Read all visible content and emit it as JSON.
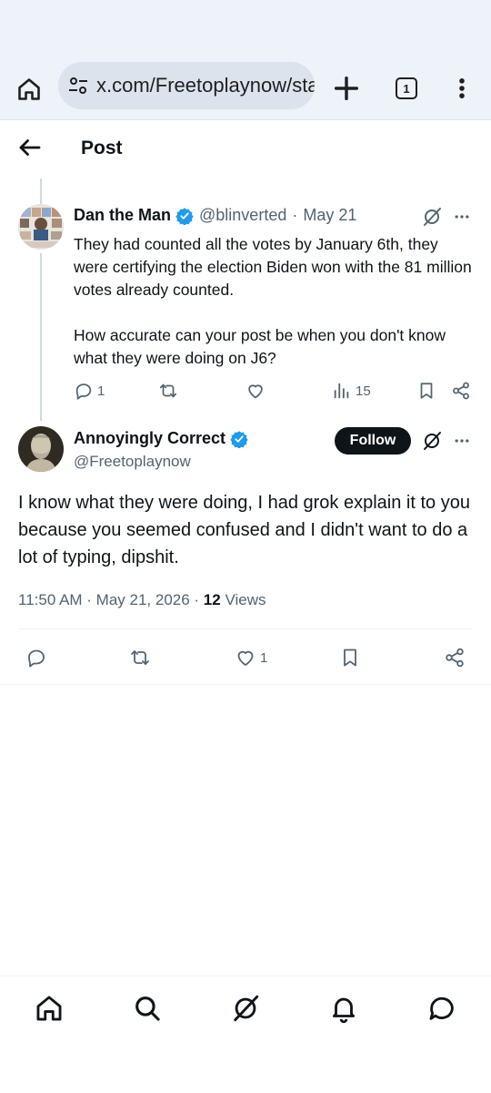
{
  "browser": {
    "url": "x.com/Freetoplaynow/sta",
    "tab_count": "1"
  },
  "header": {
    "title": "Post"
  },
  "reply": {
    "display_name": "Dan the Man",
    "handle": "@blinverted",
    "date": "May 21",
    "text": "They had counted all the votes by January 6th, they were certifying the election Biden won with the 81 million votes already counted.\n\nHow accurate can your post be when you don't know what they were doing on J6?",
    "replies": "1",
    "views": "15"
  },
  "main_post": {
    "display_name": "Annoyingly Correct",
    "handle": "@Freetoplaynow",
    "follow_label": "Follow",
    "text": "I know what they were doing, I had grok explain it to you because you seemed confused and I didn't want to do a lot of typing, dipshit.",
    "time": "11:50 AM · May 21, 2026 · ",
    "views_count": "12",
    "views_label": " Views",
    "likes": "1"
  },
  "colors": {
    "verified": "#1d9bf0",
    "secondary_text": "#536471",
    "primary_text": "#0f1419",
    "browser_chrome": "#eef2f9"
  },
  "icons": {
    "browser": [
      "home-icon",
      "site-settings-icon",
      "plus-icon",
      "tabs-icon",
      "more-vertical-icon"
    ],
    "actions": [
      "reply-icon",
      "repost-icon",
      "like-icon",
      "views-icon",
      "bookmark-icon",
      "share-icon"
    ],
    "nav": [
      "home-icon",
      "search-icon",
      "grok-icon",
      "notifications-icon",
      "messages-icon"
    ]
  }
}
